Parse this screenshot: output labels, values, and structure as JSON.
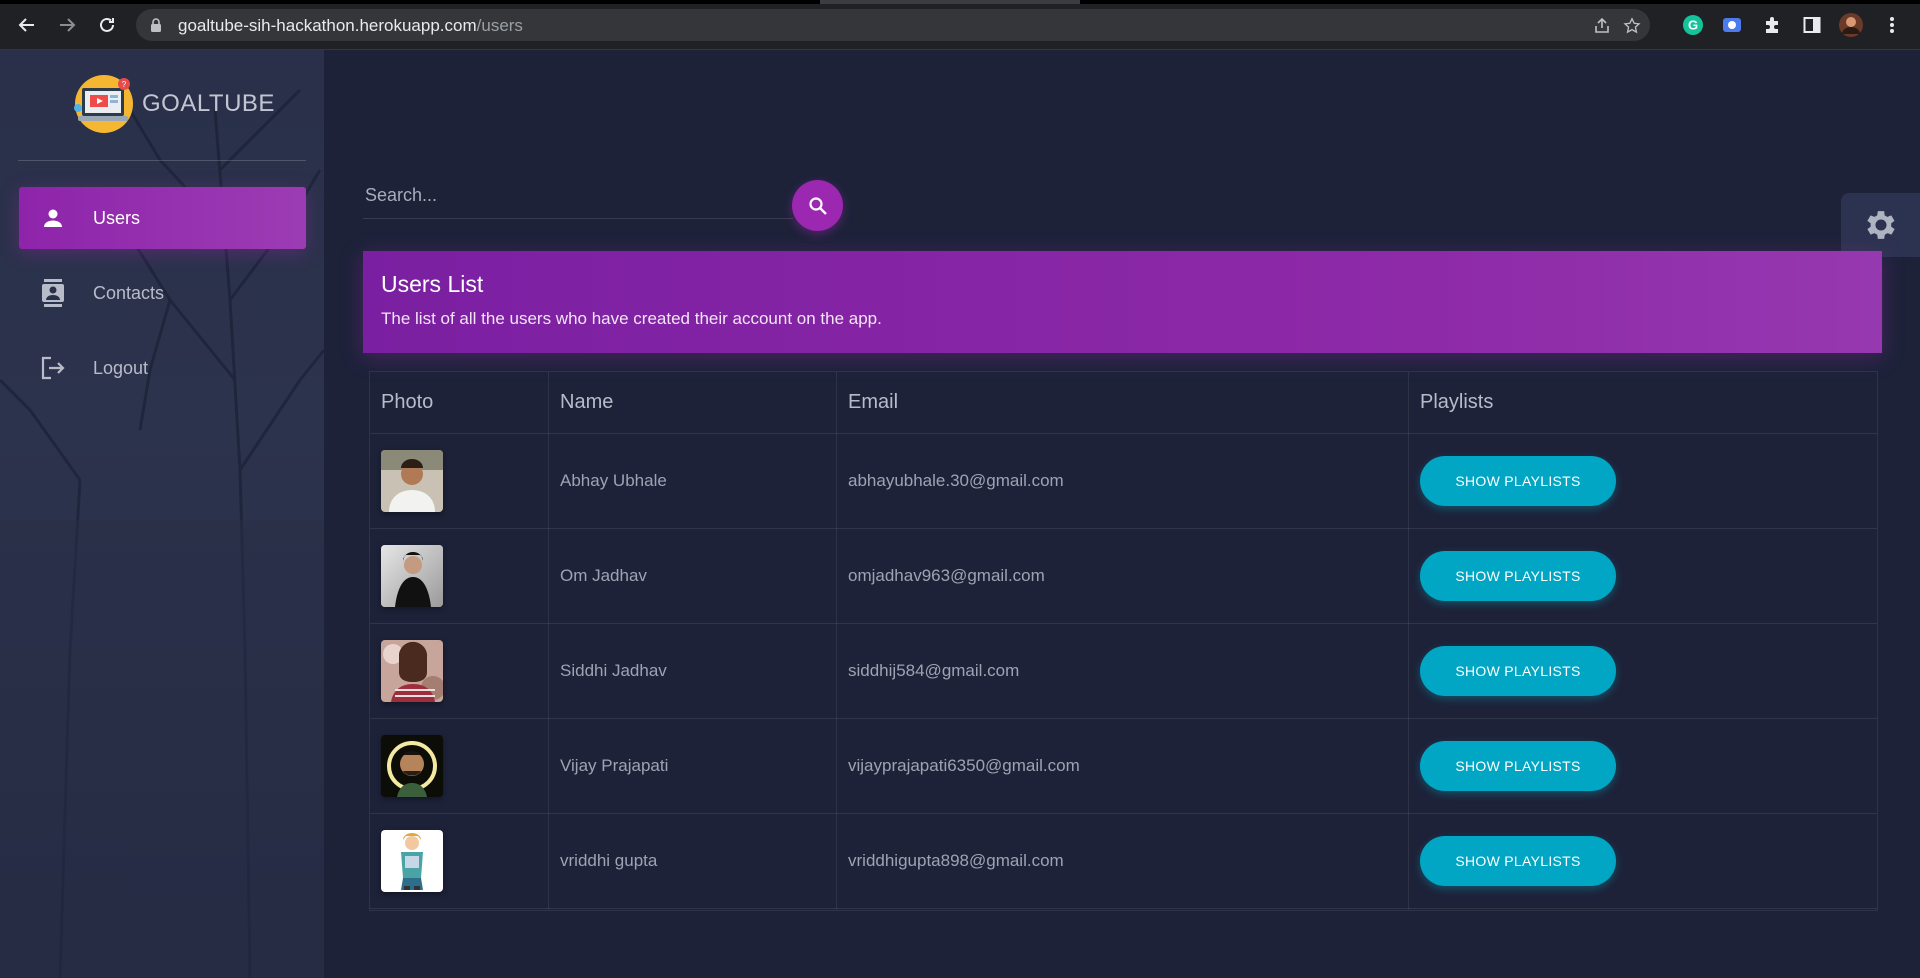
{
  "browser": {
    "url_host": "goaltube-sih-hackathon.herokuapp.com",
    "url_path": "/users"
  },
  "brand": {
    "name": "GOALTUBE"
  },
  "sidebar": {
    "items": [
      {
        "label": "Users",
        "icon": "person-icon",
        "active": true
      },
      {
        "label": "Contacts",
        "icon": "contacts-icon",
        "active": false
      },
      {
        "label": "Logout",
        "icon": "logout-icon",
        "active": false
      }
    ]
  },
  "search": {
    "placeholder": "Search..."
  },
  "card": {
    "title": "Users List",
    "subtitle": "The list of all the users who have created their account on the app."
  },
  "table": {
    "headers": [
      "Photo",
      "Name",
      "Email",
      "Playlists"
    ],
    "button_label": "SHOW PLAYLISTS",
    "rows": [
      {
        "name": "Abhay Ubhale",
        "email": "abhayubhale.30@gmail.com"
      },
      {
        "name": "Om Jadhav",
        "email": "omjadhav963@gmail.com"
      },
      {
        "name": "Siddhi Jadhav",
        "email": "siddhij584@gmail.com"
      },
      {
        "name": "Vijay Prajapati",
        "email": "vijayprajapati6350@gmail.com"
      },
      {
        "name": "vriddhi gupta",
        "email": "vriddhigupta898@gmail.com"
      }
    ]
  },
  "colors": {
    "accent": "#9c27b0",
    "button": "#00a6c4",
    "background": "#1d2239",
    "sidebar": "#2a3049"
  }
}
